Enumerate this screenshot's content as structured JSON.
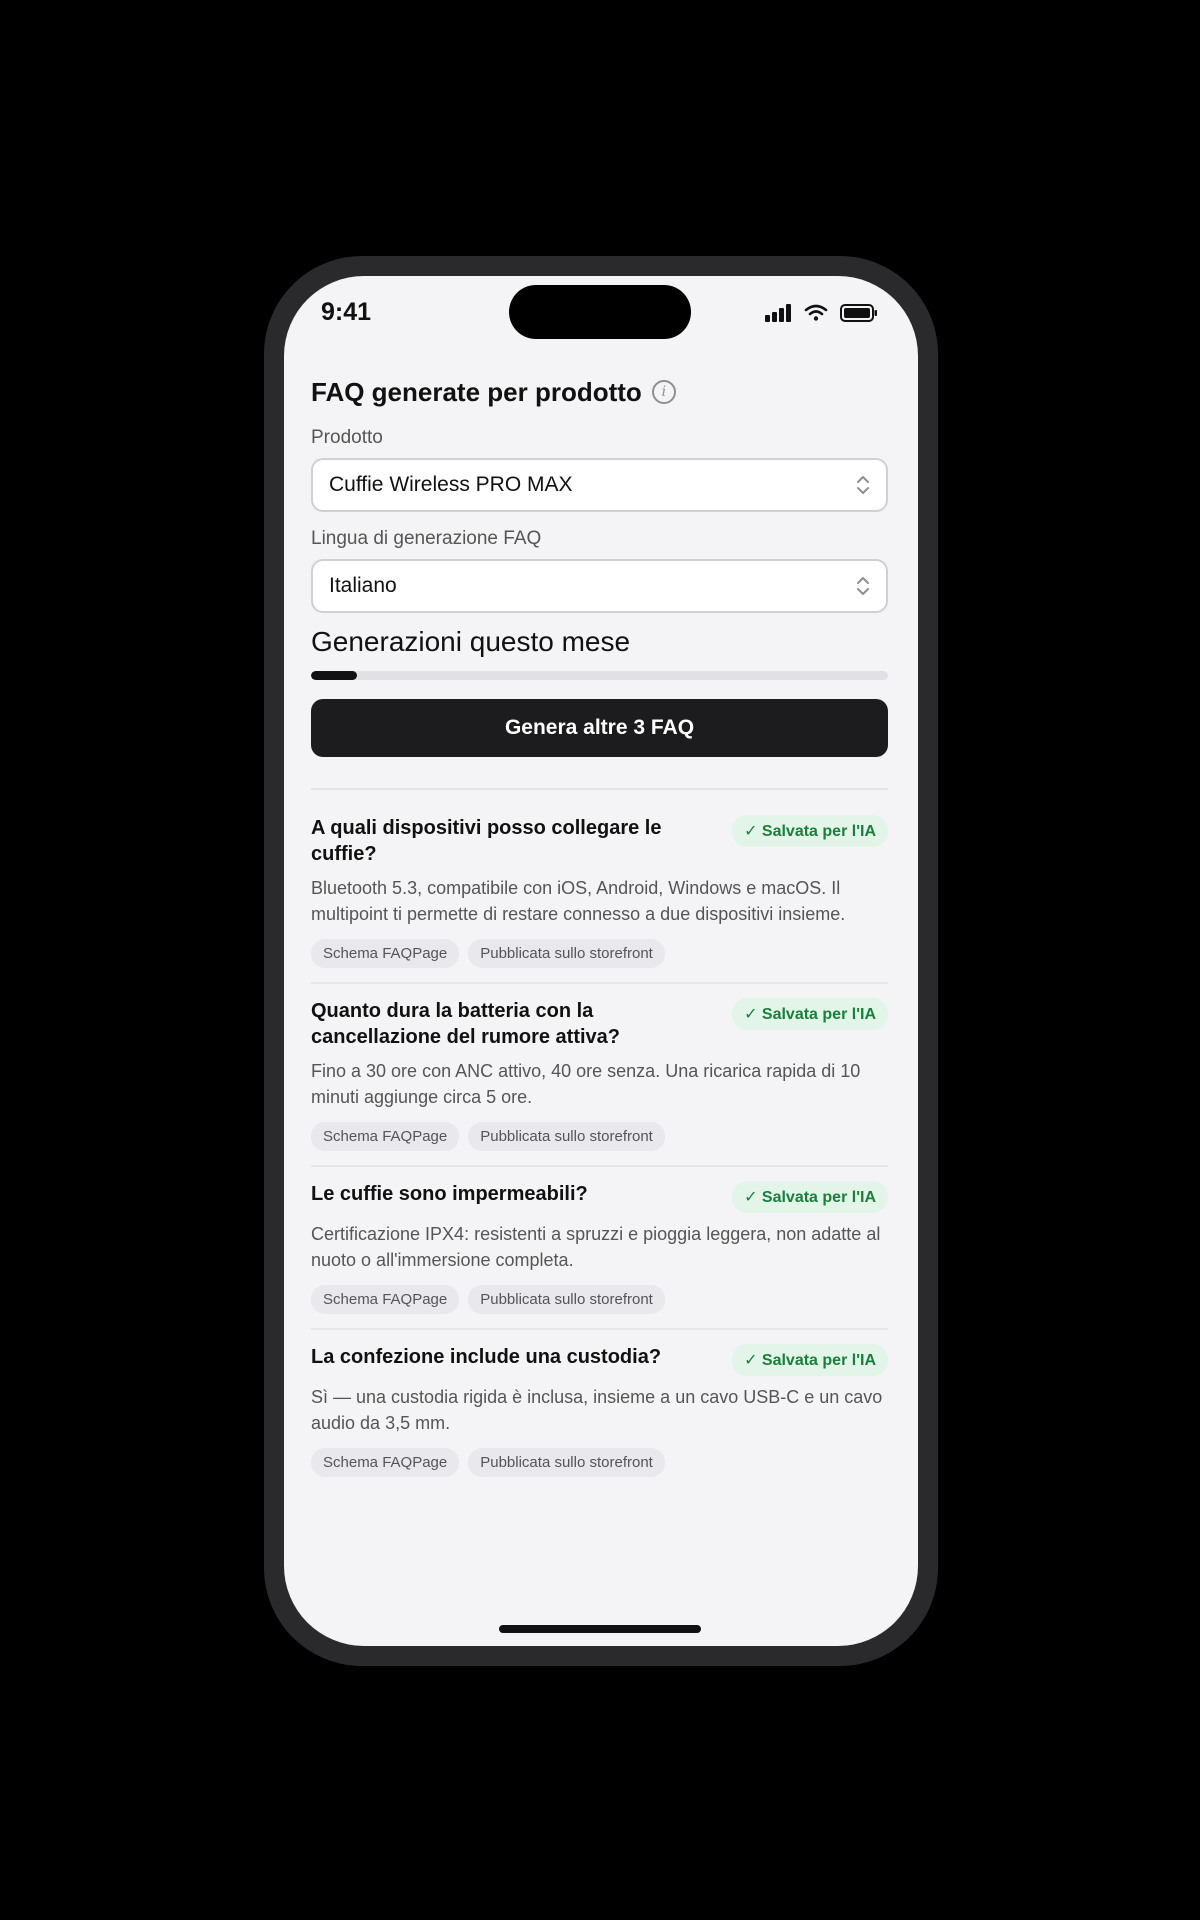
{
  "status_bar": {
    "time": "9:41",
    "icons": [
      "cellular-signal-icon",
      "wifi-icon",
      "battery-icon"
    ]
  },
  "header": {
    "title": "FAQ generate per prodotto",
    "info_icon": "info-icon"
  },
  "product_field": {
    "label": "Prodotto",
    "value": "Cuffie Wireless PRO MAX"
  },
  "language_field": {
    "label": "Lingua di generazione FAQ",
    "value": "Italiano"
  },
  "usage": {
    "title": "Generazioni questo mese",
    "progress_fraction": 0.08
  },
  "generate_button": {
    "label": "Genera altre 3 FAQ"
  },
  "faqs": [
    {
      "question": "A quali dispositivi posso collegare le cuffie?",
      "answer": "Bluetooth 5.3, compatibile con iOS, Android, Windows e macOS. Il multipoint ti permette di restare connesso a due dispositivi insieme.",
      "badge": "✓ Salvata per l'IA",
      "chips": [
        "Schema FAQPage",
        "Pubblicata sullo storefront"
      ]
    },
    {
      "question": "Quanto dura la batteria con la cancellazione del rumore attiva?",
      "answer": "Fino a 30 ore con ANC attivo, 40 ore senza. Una ricarica rapida di 10 minuti aggiunge circa 5 ore.",
      "badge": "✓ Salvata per l'IA",
      "chips": [
        "Schema FAQPage",
        "Pubblicata sullo storefront"
      ]
    },
    {
      "question": "Le cuffie sono impermeabili?",
      "answer": "Certificazione IPX4: resistenti a spruzzi e pioggia leggera, non adatte al nuoto o all'immersione completa.",
      "badge": "✓ Salvata per l'IA",
      "chips": [
        "Schema FAQPage",
        "Pubblicata sullo storefront"
      ]
    },
    {
      "question": "La confezione include una custodia?",
      "answer": "Sì — una custodia rigida è inclusa, insieme a un cavo USB-C e un cavo audio da 3,5 mm.",
      "badge": "✓ Salvata per l'IA",
      "chips": [
        "Schema FAQPage",
        "Pubblicata sullo storefront"
      ]
    }
  ],
  "colors": {
    "screen_background": "#f4f4f6",
    "primary_button": "#1c1c1e",
    "badge_background": "#e3f5e8",
    "badge_text": "#1a7f3c"
  }
}
